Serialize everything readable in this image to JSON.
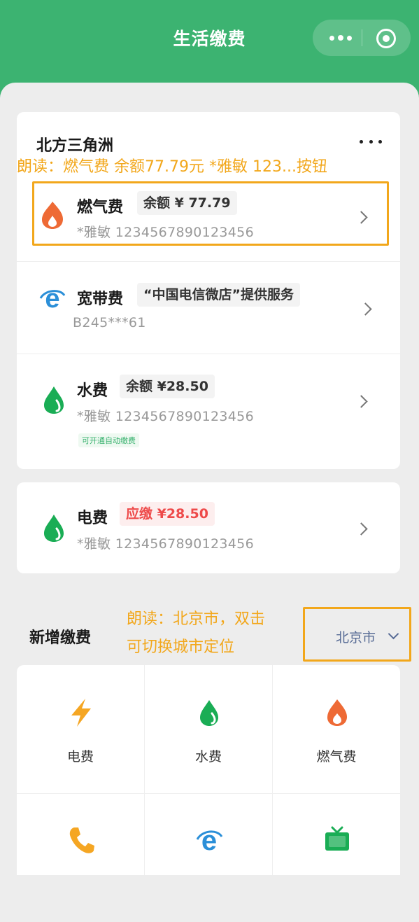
{
  "nav": {
    "title": "生活缴费"
  },
  "group": {
    "title": "北方三角洲"
  },
  "annotations": {
    "bill_focus": "朗读：燃气费 余额77.79元 *雅敏 123...按钮",
    "city_line1": "朗读：北京市，双击",
    "city_line2": "可切换城市定位"
  },
  "bills": [
    {
      "name": "燃气费",
      "tag": "余额 ¥ 77.79",
      "sub": "*雅敏  1234567890123456",
      "icon": "flame-icon"
    },
    {
      "name": "宽带费",
      "tag": "“中国电信微店”提供服务",
      "sub": "B245***61",
      "icon": "broadband-e-icon"
    },
    {
      "name": "水费",
      "tag": "余额 ¥28.50",
      "sub": "*雅敏  1234567890123456",
      "badge": "可开通自动缴费",
      "icon": "water-drop-icon"
    },
    {
      "name": "电费",
      "tag": "应缴 ¥28.50",
      "sub": "*雅敏  1234567890123456",
      "icon": "water-drop-icon"
    }
  ],
  "add": {
    "title": "新增缴费",
    "city": "北京市",
    "items": [
      {
        "label": "电费",
        "icon": "lightning-icon"
      },
      {
        "label": "水费",
        "icon": "water-drop-icon"
      },
      {
        "label": "燃气费",
        "icon": "flame-icon"
      },
      {
        "label": "",
        "icon": "phone-icon"
      },
      {
        "label": "",
        "icon": "broadband-e-icon"
      },
      {
        "label": "",
        "icon": "tv-icon"
      }
    ]
  },
  "colors": {
    "brand_green": "#3cb371",
    "annotation_orange": "#f2a71b",
    "flame_orange": "#ee6a35",
    "amount_due_red": "#ee4a4a",
    "broadband_blue": "#2b8fd8",
    "city_link": "#576b95"
  }
}
